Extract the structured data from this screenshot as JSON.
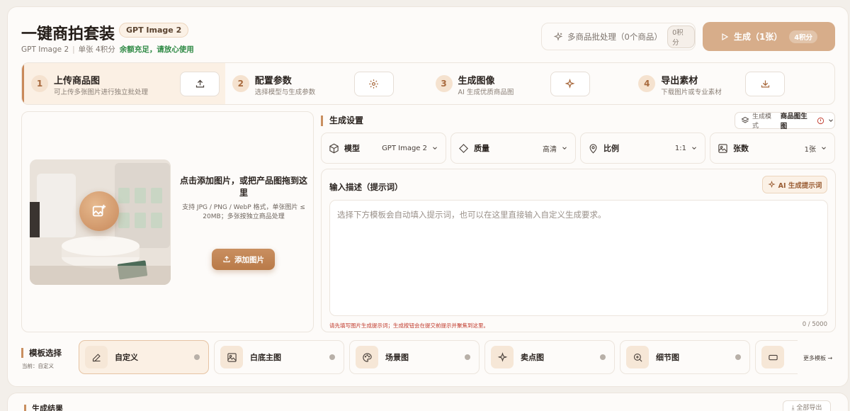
{
  "header": {
    "title": "一键商拍套装",
    "model_pill": "GPT Image 2",
    "sub_model": "GPT Image 2",
    "sub_cost": "单张 4积分",
    "sub_balance": "余额充足，请放心使用",
    "batch_label": "多商品批处理（0个商品）",
    "batch_badge": "0积分",
    "generate_label": "生成（1张）",
    "generate_badge": "4积分"
  },
  "steps": [
    {
      "num": "1",
      "title": "上传商品图",
      "desc": "可上传多张图片进行独立批处理",
      "icon": "upload-icon"
    },
    {
      "num": "2",
      "title": "配置参数",
      "desc": "选择模型与生成参数",
      "icon": "gear-icon"
    },
    {
      "num": "3",
      "title": "生成图像",
      "desc": "AI 生成优质商品图",
      "icon": "sparkle-icon"
    },
    {
      "num": "4",
      "title": "导出素材",
      "desc": "下载图片或专业素材",
      "icon": "download-icon"
    }
  ],
  "upload": {
    "title": "点击添加图片，或把产品图拖到这里",
    "desc": "支持 JPG / PNG / WebP 格式，单张图片 ≤ 20MB；多张按独立商品处理",
    "button": "添加图片"
  },
  "settings": {
    "title": "生成设置",
    "mode_prefix": "生成模式",
    "mode_value": "商品图生图",
    "params": [
      {
        "label": "模型",
        "value": "GPT Image 2",
        "icon": "cube-icon"
      },
      {
        "label": "质量",
        "value": "高清",
        "icon": "diamond-icon"
      },
      {
        "label": "比例",
        "value": "1:1",
        "icon": "pin-icon"
      },
      {
        "label": "张数",
        "value": "1张",
        "icon": "images-icon"
      }
    ]
  },
  "prompt": {
    "label": "输入描述（提示词）",
    "ai_button": "AI 生成提示词",
    "placeholder": "选择下方模板会自动填入提示词，也可以在这里直接输入自定义生成要求。",
    "warning": "请先填写图片生成提示词；生成按钮会在提交前提示并聚焦到这里。",
    "counter": "0 / 5000"
  },
  "templates": {
    "title": "模板选择",
    "current": "当前：自定义",
    "more": "更多模板 →",
    "items": [
      {
        "name": "自定义",
        "icon": "pencil-icon"
      },
      {
        "name": "白底主图",
        "icon": "image-icon"
      },
      {
        "name": "场景图",
        "icon": "palette-icon"
      },
      {
        "name": "卖点图",
        "icon": "sparkle-icon"
      },
      {
        "name": "细节图",
        "icon": "zoom-icon"
      }
    ]
  },
  "results": {
    "title": "生成结果",
    "export": "全部导出"
  },
  "colors": {
    "accent": "#c98f60",
    "generate_button": "#d7ad8a",
    "success": "#2f8a45",
    "warning": "#c0392b"
  }
}
